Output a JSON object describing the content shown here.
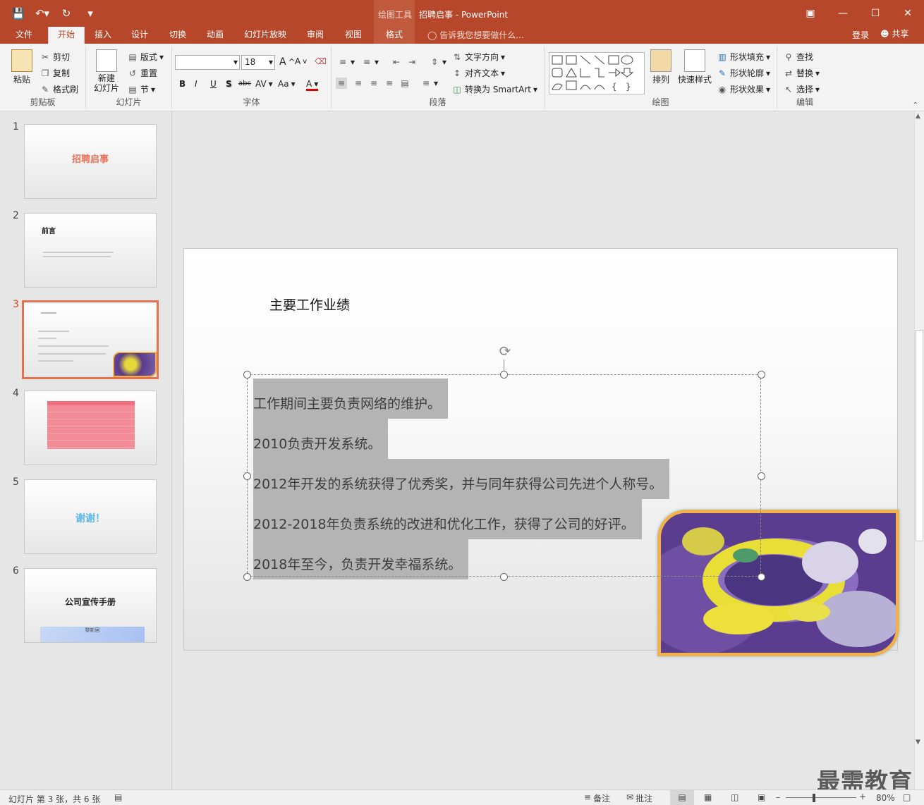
{
  "titlebar": {
    "context_label": "绘图工具",
    "doc_title": "招聘启事 - PowerPoint"
  },
  "tabs": [
    "文件",
    "开始",
    "插入",
    "设计",
    "切换",
    "动画",
    "幻灯片放映",
    "审阅",
    "视图",
    "格式"
  ],
  "tell_me": "告诉我您想要做什么...",
  "login": "登录",
  "share": "共享",
  "ribbon": {
    "clipboard": {
      "paste": "粘贴",
      "cut": "剪切",
      "copy": "复制",
      "format_painter": "格式刷",
      "label": "剪贴板"
    },
    "slides": {
      "new_slide": "新建\n幻灯片",
      "layout": "版式",
      "reset": "重置",
      "section": "节",
      "label": "幻灯片"
    },
    "font": {
      "font_name": "",
      "font_size": "18",
      "label": "字体",
      "bold": "B",
      "italic": "I",
      "underline": "U",
      "shadow": "S",
      "strike": "abc",
      "spacing": "AV",
      "case": "Aa",
      "color": "A"
    },
    "paragraph": {
      "text_direction": "文字方向",
      "align_text": "对齐文本",
      "smartart": "转换为 SmartArt",
      "label": "段落"
    },
    "drawing": {
      "arrange": "排列",
      "quick_styles": "快速样式",
      "shape_fill": "形状填充",
      "shape_outline": "形状轮廓",
      "shape_effects": "形状效果",
      "label": "绘图"
    },
    "editing": {
      "find": "查找",
      "replace": "替换",
      "select": "选择",
      "label": "编辑"
    }
  },
  "thumbnails": [
    {
      "num": "1",
      "title": "招聘启事"
    },
    {
      "num": "2",
      "title": "前言"
    },
    {
      "num": "3",
      "title": ""
    },
    {
      "num": "4",
      "title": ""
    },
    {
      "num": "5",
      "title": "谢谢！"
    },
    {
      "num": "6",
      "title": "公司宣传手册",
      "subtitle": "黎新居"
    }
  ],
  "slide": {
    "title": "主要工作业绩",
    "lines": [
      "工作期间主要负责网络的维护。",
      "2010负责开发系统。",
      "2012年开发的系统获得了优秀奖，并与同年获得公司先进个人称号。",
      "2012-2018年负责系统的改进和优化工作，获得了公司的好评。",
      "2018年至今，负责开发幸福系统。"
    ]
  },
  "status": {
    "slide_info": "幻灯片 第 3 张，共 6 张",
    "notes": "备注",
    "comments": "批注",
    "zoom": "80%"
  },
  "watermark": "最需教育",
  "colors": {
    "accent": "#b7472a",
    "selected_thumb": "#e5734f",
    "photo_border": "#f0b24b"
  }
}
